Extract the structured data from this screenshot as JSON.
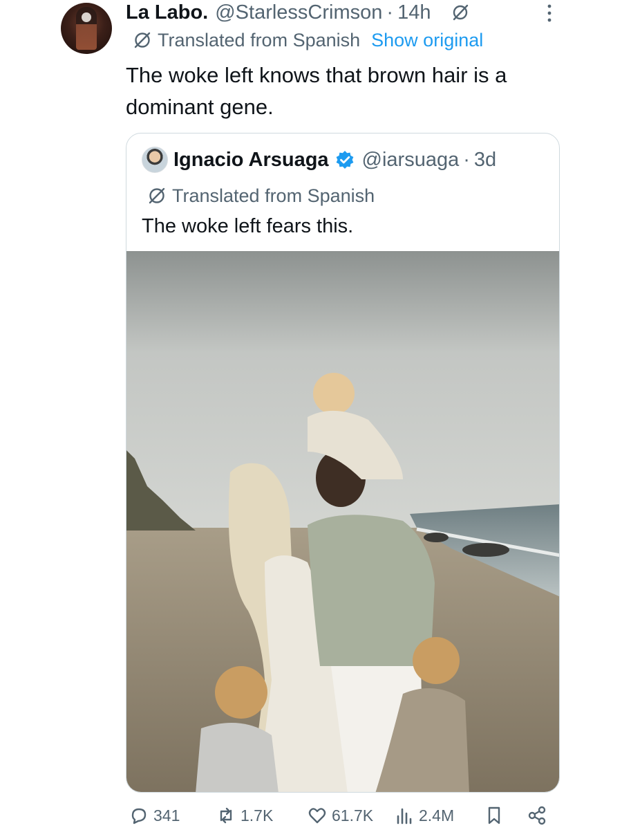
{
  "tweet": {
    "author_name": "La Labo.",
    "handle": "@StarlessCrimson",
    "separator": "·",
    "time": "14h",
    "translated_label": "Translated from Spanish",
    "show_original": "Show original",
    "text": "The woke left knows that brown hair is a dominant gene."
  },
  "quote": {
    "author_name": "Ignacio Arsuaga",
    "verified": true,
    "handle": "@iarsuaga",
    "separator": "·",
    "time": "3d",
    "translated_label": "Translated from Spanish",
    "text": "The woke left fears this."
  },
  "actions": {
    "replies": "341",
    "reposts": "1.7K",
    "likes": "61.7K",
    "views": "2.4M"
  },
  "colors": {
    "accent": "#1d9bf0",
    "secondary_text": "#536471",
    "primary_text": "#0f1419",
    "border": "#cfd9de"
  },
  "icons": [
    "translate-icon",
    "more-icon",
    "verified-badge-icon",
    "reply-icon",
    "repost-icon",
    "like-icon",
    "views-icon",
    "bookmark-icon",
    "share-icon"
  ]
}
